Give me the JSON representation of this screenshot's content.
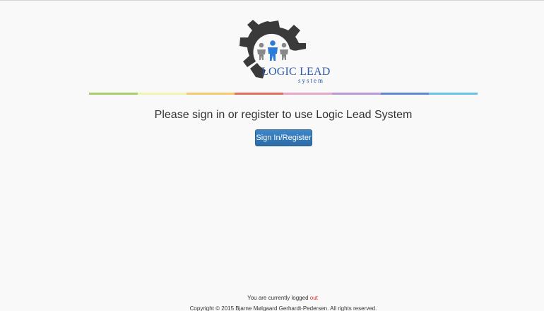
{
  "logo": {
    "title": "LOGIC LEAD",
    "subtitle": "system"
  },
  "divider_colors": [
    "#a8cf6a",
    "#f1f3b0",
    "#f4c86d",
    "#e06f5e",
    "#e7a8c7",
    "#b79ad8",
    "#5f86d3",
    "#6bc0e6"
  ],
  "main": {
    "prompt": "Please sign in or register to use Logic Lead System",
    "signin_label": "Sign In/Register"
  },
  "footer": {
    "status_prefix": "You are currently logged",
    "status_state": "out",
    "copyright": "Copyright © 2015 Bjarne Mølgaard Gerhardt-Pedersen. All rights reserved."
  },
  "colors": {
    "accent": "#3378b7",
    "logged_out": "#d9302c",
    "logo_text": "#2a5aa8"
  }
}
